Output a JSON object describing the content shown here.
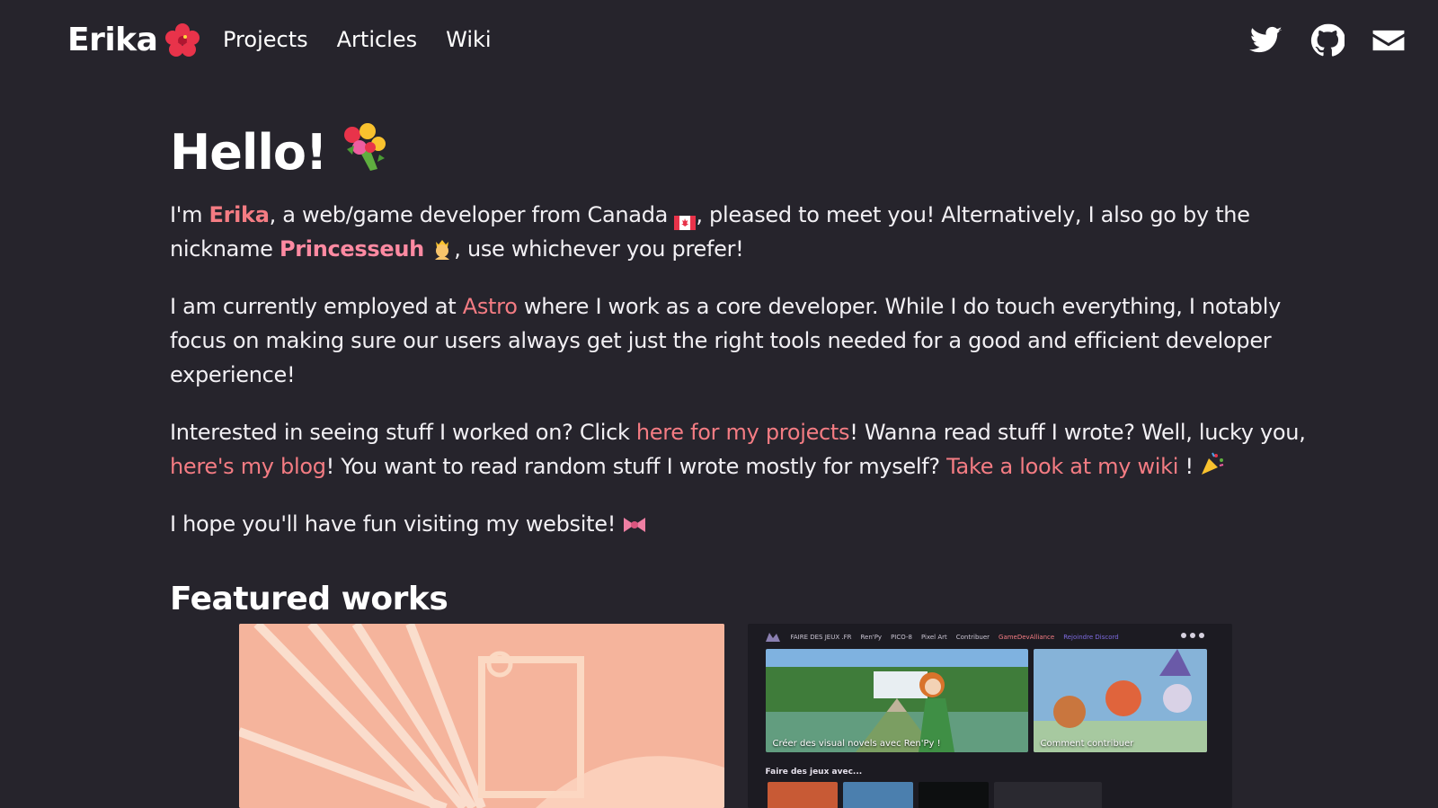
{
  "brand": {
    "name": "Erika",
    "emoji": "hibiscus"
  },
  "nav": {
    "links": [
      "Projects",
      "Articles",
      "Wiki"
    ]
  },
  "socials": [
    "twitter-icon",
    "github-icon",
    "mail-icon"
  ],
  "colors": {
    "background": "#26242c",
    "accent": "#f47c83",
    "text": "#f2f0f4"
  },
  "hero": {
    "title": "Hello!",
    "p1": {
      "a": "I'm ",
      "name": "Erika",
      "b": ", a web/game developer from Canada ",
      "c": ", pleased to meet you! Alternatively, I also go by the nickname ",
      "nickname": "Princesseuh",
      "d": ", use whichever you prefer!"
    },
    "p2": {
      "a": "I am currently employed at ",
      "company": "Astro",
      "b": " where I work as a core developer. While I do touch everything, I notably focus on making sure our users always get just the right tools needed for a good and efficient developer experience!"
    },
    "p3": {
      "a": "Interested in seeing stuff I worked on? Click ",
      "link1": "here for my projects",
      "b": "! Wanna read stuff I wrote? Well, lucky you, ",
      "link2": "here's my blog",
      "c": "! You want to read random stuff I wrote mostly for myself? ",
      "link3": "Take a look at my wiki",
      "d": " !"
    },
    "p4": {
      "a": "I hope you'll have fun visiting my website!"
    }
  },
  "featured": {
    "title": "Featured works",
    "card2": {
      "nav": [
        "FAIRE DES JEUX .FR",
        "Ren'Py",
        "PICO-8",
        "Pixel Art",
        "Contribuer",
        "GameDevAlliance",
        "Rejoindre Discord"
      ],
      "tile1_caption": "Créer des visual novels avec Ren'Py !",
      "tile2_caption": "Comment contribuer",
      "subheading": "Faire des jeux avec..."
    }
  }
}
